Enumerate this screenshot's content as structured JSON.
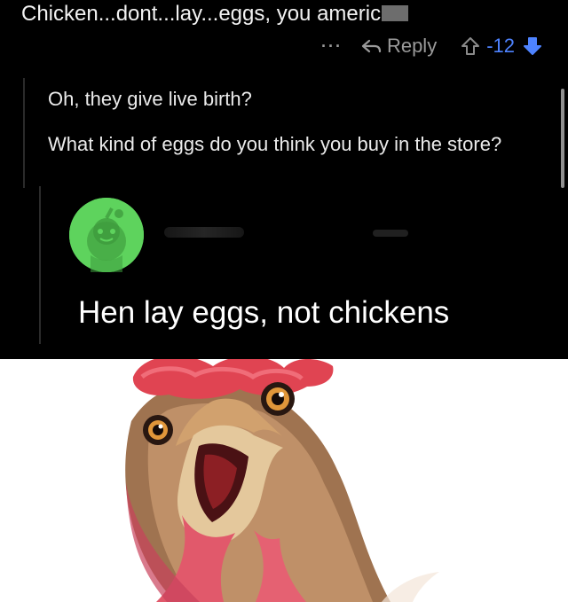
{
  "comment": {
    "top_text": "Chicken...dont...lay...eggs, you americ",
    "actions": {
      "more": "···",
      "reply": "Reply",
      "score": "-12"
    }
  },
  "reply": {
    "line_1": "Oh, they give live birth?",
    "line_2": "What kind of eggs do you think you buy in the store?"
  },
  "quoted": {
    "text": "Hen lay eggs, not chickens"
  },
  "icons": {
    "more": "more-dots-icon",
    "reply": "reply-arrow-icon",
    "upvote": "upvote-arrow-icon",
    "downvote": "downvote-arrow-icon",
    "avatar": "snoo-avatar-icon"
  },
  "colors": {
    "background": "#000000",
    "accent": "#4e83ff",
    "avatar_green": "#5ed35d",
    "text": "#ebebeb"
  }
}
